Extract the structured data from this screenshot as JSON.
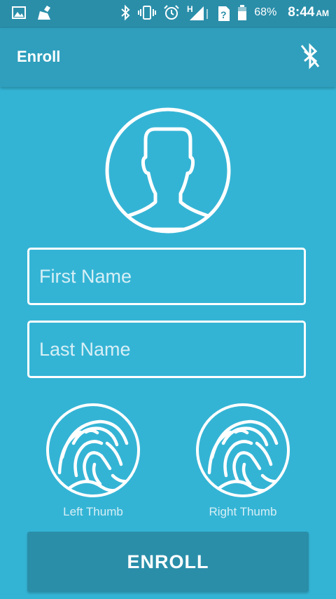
{
  "status_bar": {
    "icons": [
      "image-icon",
      "cleaner-icon",
      "bluetooth-icon",
      "vibrate-icon",
      "alarm-icon",
      "signal-h-icon",
      "sim-unknown-icon",
      "battery-icon"
    ],
    "battery_percent": "68%",
    "time": "8:44",
    "ampm": "AM"
  },
  "app_bar": {
    "title": "Enroll",
    "action_icon": "bluetooth-disabled-icon"
  },
  "form": {
    "avatar_icon": "user-avatar-icon",
    "first_name": {
      "value": "",
      "placeholder": "First Name"
    },
    "last_name": {
      "value": "",
      "placeholder": "Last Name"
    }
  },
  "thumbs": {
    "icon": "fingerprint-icon",
    "left_label": "Left Thumb",
    "right_label": "Right Thumb"
  },
  "enroll_button": {
    "label": "ENROLL"
  },
  "colors": {
    "background": "#34b4d5",
    "app_bar": "#2f9fbd",
    "status_bar": "#2a8ea9",
    "button": "#2a8ea9",
    "foreground": "#ffffff"
  }
}
